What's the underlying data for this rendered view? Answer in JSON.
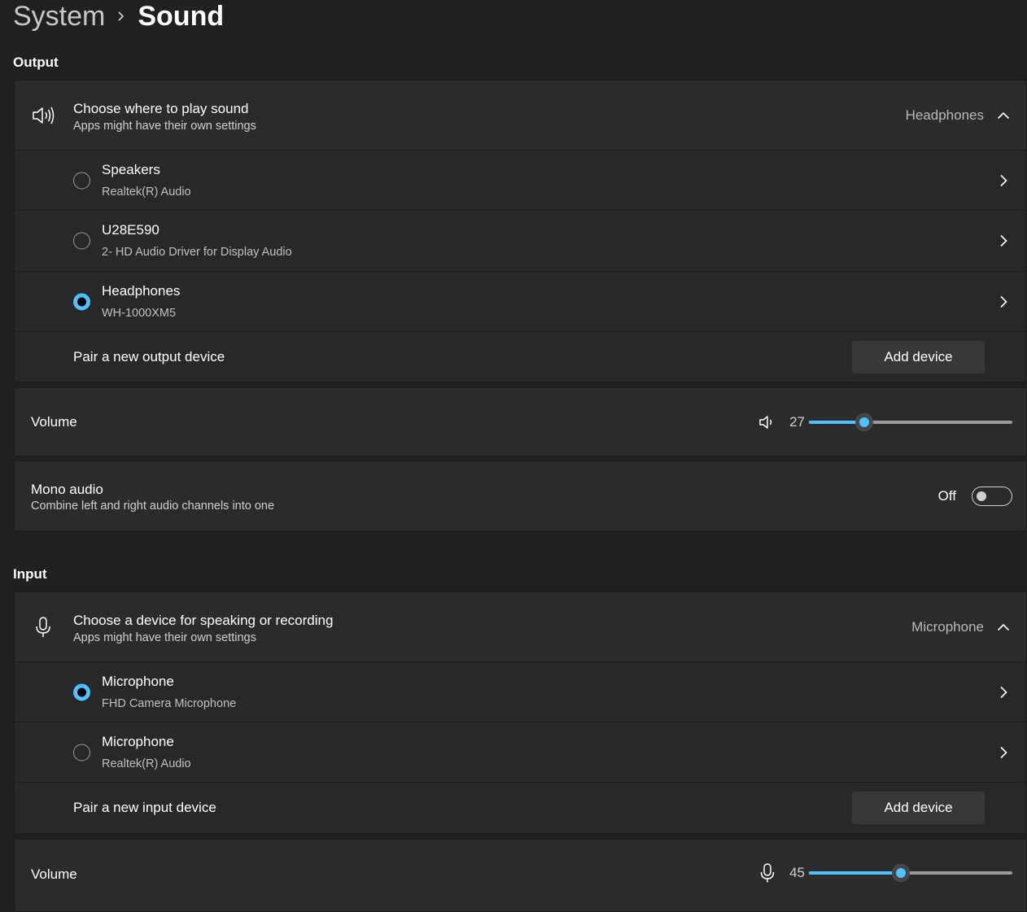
{
  "breadcrumb": {
    "parent": "System",
    "current": "Sound"
  },
  "output": {
    "section_title": "Output",
    "chooser": {
      "title": "Choose where to play sound",
      "subtitle": "Apps might have their own settings",
      "selected": "Headphones"
    },
    "devices": [
      {
        "name": "Speakers",
        "description": "Realtek(R) Audio",
        "selected": false
      },
      {
        "name": "U28E590",
        "description": "2- HD Audio Driver for Display Audio",
        "selected": false
      },
      {
        "name": "Headphones",
        "description": "WH-1000XM5",
        "selected": true
      }
    ],
    "pair": {
      "label": "Pair a new output device",
      "button": "Add device"
    },
    "volume": {
      "label": "Volume",
      "value": "27",
      "fraction": 0.27
    },
    "mono": {
      "title": "Mono audio",
      "subtitle": "Combine left and right audio channels into one",
      "state": "Off"
    }
  },
  "input": {
    "section_title": "Input",
    "chooser": {
      "title": "Choose a device for speaking or recording",
      "subtitle": "Apps might have their own settings",
      "selected": "Microphone"
    },
    "devices": [
      {
        "name": "Microphone",
        "description": "FHD Camera Microphone",
        "selected": true
      },
      {
        "name": "Microphone",
        "description": "Realtek(R) Audio",
        "selected": false
      }
    ],
    "pair": {
      "label": "Pair a new input device",
      "button": "Add device"
    },
    "volume": {
      "label": "Volume",
      "value": "45",
      "fraction": 0.45
    }
  },
  "colors": {
    "accent": "#4cc2ff",
    "background": "#202020",
    "card": "#2b2b2b"
  }
}
